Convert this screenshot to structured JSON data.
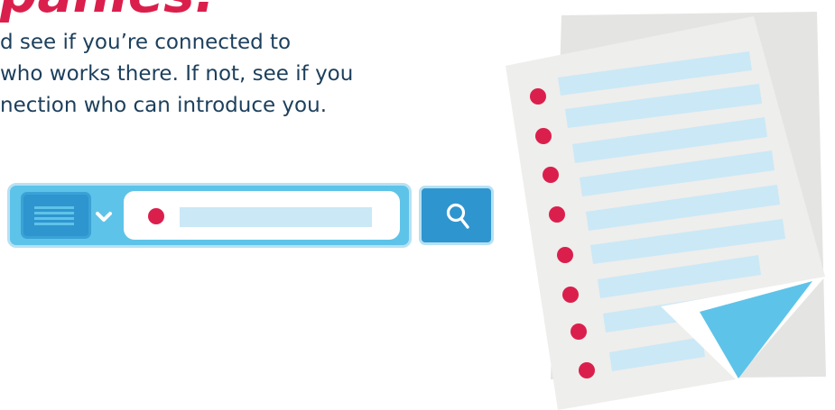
{
  "hero": {
    "heading": "panies.",
    "body_lines": [
      "d see if you’re connected to",
      "who works there. If not, see if you",
      "nection who can introduce you."
    ]
  },
  "colors": {
    "accent_red": "#db1f4c",
    "text_navy": "#1c3f5c",
    "bar_blue": "#5ec3e8",
    "icon_blue": "#2f95cf",
    "line_light_blue": "#cbe8f6",
    "paper_grey": "#eeeeec",
    "paper_shadow": "#e4e5e3",
    "fold_blue": "#5ec3e8",
    "fold_white": "#ffffff"
  },
  "search_widget": {
    "filter_icon": "menu-lines-icon",
    "chevron_icon": "chevron-down-icon",
    "button_icon": "search-icon"
  },
  "illustration": {
    "list_bullet_count": 8,
    "folded_corner_icon": "page-curl-icon"
  }
}
